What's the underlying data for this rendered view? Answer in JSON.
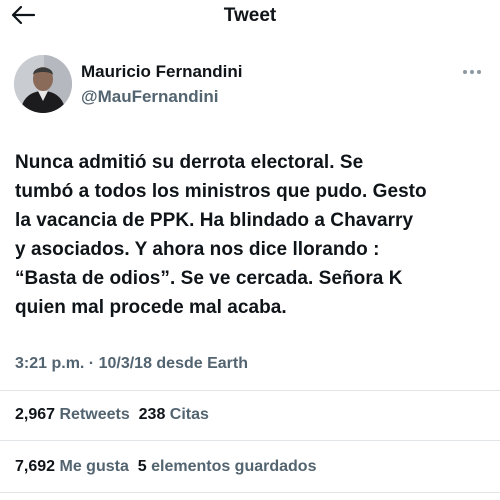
{
  "header": {
    "title": "Tweet",
    "back_icon": "arrow-left-icon"
  },
  "author": {
    "name": "Mauricio Fernandini",
    "handle": "@MauFernandini",
    "more_icon": "more-horizontal-icon"
  },
  "tweet": {
    "lines": [
      "Nunca admitió su derrota electoral. Se",
      "tumbó a todos los ministros que pudo. Gesto",
      "la vacancia de PPK. Ha blindado a Chavarry",
      "y asociados. Y ahora nos dice llorando :",
      "“Basta de odios”. Se ve cercada. Señora K",
      "quien mal procede mal acaba."
    ],
    "timestamp": "3:21 p.m. · 10/3/18 desde Earth"
  },
  "stats": {
    "retweets_count": "2,967",
    "retweets_label": "Retweets",
    "quotes_count": "238",
    "quotes_label": "Citas",
    "likes_count": "7,692",
    "likes_label": "Me gusta",
    "bookmarks_count": "5",
    "bookmarks_label": "elementos guardados"
  }
}
